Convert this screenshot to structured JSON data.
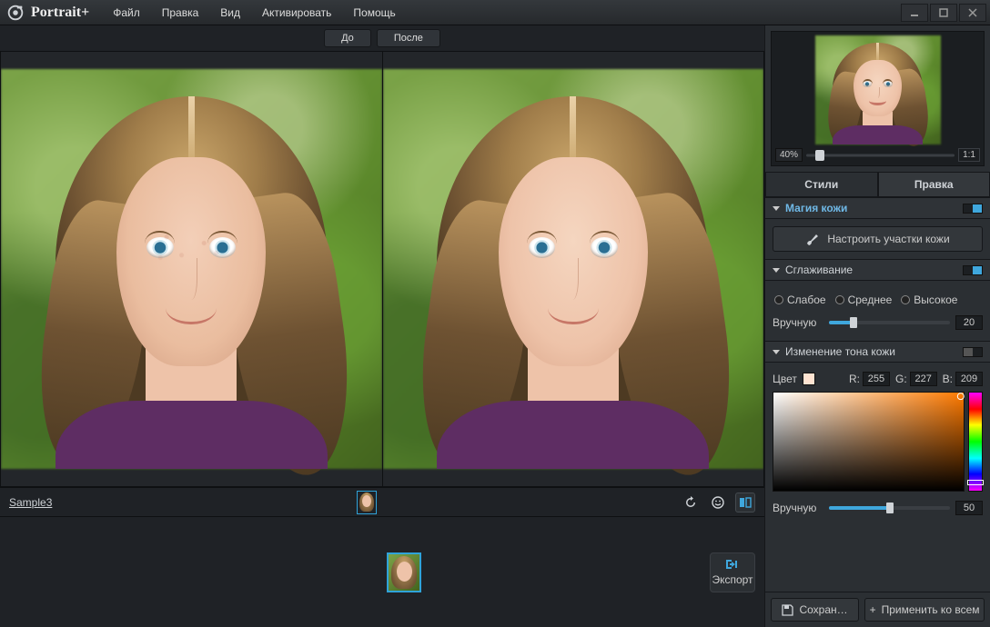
{
  "app_name": "Portrait+",
  "menu": {
    "file": "Файл",
    "edit": "Правка",
    "view": "Вид",
    "activate": "Активировать",
    "help": "Помощь"
  },
  "compare": {
    "before": "До",
    "after": "После"
  },
  "filmstrip": {
    "filename": "Sample3",
    "export": "Экспорт"
  },
  "navigator": {
    "zoom": "40%",
    "one_to_one": "1:1"
  },
  "tabs": {
    "styles": "Стили",
    "edit": "Правка"
  },
  "skin_magic": {
    "title": "Магия кожи",
    "configure_btn": "Настроить участки кожи"
  },
  "smoothing": {
    "title": "Сглаживание",
    "low": "Слабое",
    "medium": "Среднее",
    "high": "Высокое",
    "manual_label": "Вручную",
    "manual_value": "20"
  },
  "tone": {
    "title": "Изменение тона кожи",
    "color_label": "Цвет",
    "r_label": "R:",
    "g_label": "G:",
    "b_label": "B:",
    "r": "255",
    "g": "227",
    "b": "209",
    "swatch_color": "#ffe3d1",
    "manual_label": "Вручную",
    "manual_value": "50"
  },
  "bottom": {
    "save": "Сохран…",
    "apply_all_prefix": "+",
    "apply_all": "Применить ко всем"
  }
}
